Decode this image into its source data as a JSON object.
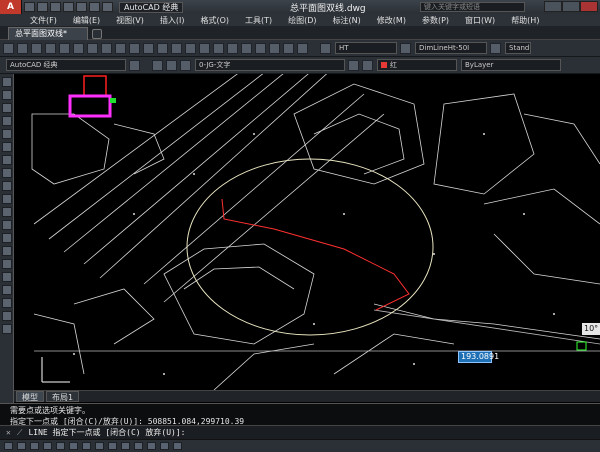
{
  "title_bar": {
    "logo": "A",
    "workspace": "AutoCAD 经典",
    "document_title": "总平面图双线.dwg",
    "search_placeholder": "键入关键字或短语"
  },
  "menu": [
    "文件(F)",
    "编辑(E)",
    "视图(V)",
    "插入(I)",
    "格式(O)",
    "工具(T)",
    "绘图(D)",
    "标注(N)",
    "修改(M)",
    "参数(P)",
    "窗口(W)",
    "帮助(H)"
  ],
  "tabs": {
    "active": "总平面图双线*"
  },
  "toolbar1": {
    "text_style": "HT",
    "dim_style": "DimLineHt-50I",
    "table_style": "Stand"
  },
  "toolbar2": {
    "workspace_combo": "AutoCAD 经典",
    "layer_combo": "0-JG-文字",
    "color_combo": "红",
    "linetype_combo": "ByLayer",
    "color_hex": "#e53935"
  },
  "layout_tabs": [
    "模型",
    "布局1"
  ],
  "command": {
    "history_line1": "需要点或选项关键字。",
    "history_line2": "指定下一点或 [闭合(C)/放弃(U)]: 508851.084,299710.39",
    "prompt": "LINE 指定下一点或 [闭合(C) 放弃(U)]:"
  },
  "dynamic_input": {
    "length": "193.0891",
    "angle": "10°"
  }
}
